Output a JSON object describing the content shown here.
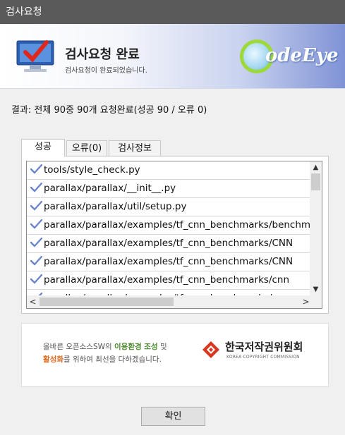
{
  "window": {
    "title": "검사요청"
  },
  "header": {
    "title": "검사요청 완료",
    "subtitle": "검사요청이 완료되었습니다.",
    "logo_text": "odeEye"
  },
  "result_text": "결과: 전체 90중 90개 요청완료(성공 90 / 오류 0)",
  "tabs": [
    {
      "label": "성공",
      "active": true
    },
    {
      "label": "오류(0)",
      "active": false
    },
    {
      "label": "검사정보",
      "active": false
    }
  ],
  "files": [
    "tools/style_check.py",
    "parallax/parallax/__init__.py",
    "parallax/parallax/util/setup.py",
    "parallax/parallax/examples/tf_cnn_benchmarks/benchmark_cnn.py",
    "parallax/parallax/examples/tf_cnn_benchmarks/CNN",
    "parallax/parallax/examples/tf_cnn_benchmarks/CNN",
    "parallax/parallax/examples/tf_cnn_benchmarks/cnn",
    "parallax/parallax/examples/tf_cnn_benchmarks/"
  ],
  "icons": {
    "check": "check-icon",
    "scroll_up": "▲",
    "scroll_down": "▼",
    "scroll_left": "<",
    "scroll_right": ">"
  },
  "banner": {
    "line1_pre": "올바른 오픈소스SW의 ",
    "line1_highlight": "이용환경 조성",
    "line1_post": " 및",
    "line2_highlight": "활성화",
    "line2_post": "를 위하여 최선을 다하겠습니다.",
    "org_name": "한국저작권위원회",
    "org_name_en": "KOREA COPYRIGHT COMMISSION"
  },
  "ok_button": {
    "label": "확인"
  },
  "colors": {
    "titlebar": "#5a5a5a",
    "check": "#6a86c8",
    "banner_green": "#4a8a2c",
    "banner_orange": "#e06a1e",
    "logo_red": "#d9361f"
  }
}
